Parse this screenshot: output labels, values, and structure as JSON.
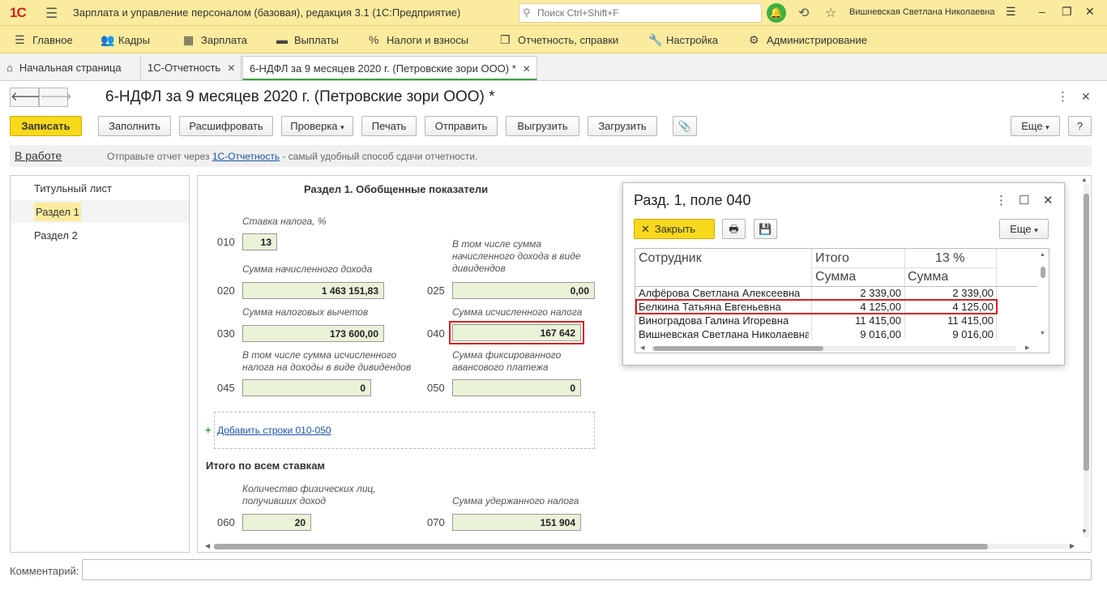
{
  "titlebar": {
    "logo": "1С",
    "app_title": "Зарплата и управление персоналом (базовая), редакция 3.1  (1С:Предприятие)",
    "search_placeholder": "Поиск Ctrl+Shift+F",
    "user": "Вишневская Светлана Николаевна"
  },
  "menu": [
    {
      "label": "Главное",
      "icon": "burger-icon"
    },
    {
      "label": "Кадры",
      "icon": "people-icon"
    },
    {
      "label": "Зарплата",
      "icon": "calculator-icon"
    },
    {
      "label": "Выплаты",
      "icon": "wallet-icon"
    },
    {
      "label": "Налоги и взносы",
      "icon": "percent-icon"
    },
    {
      "label": "Отчетность, справки",
      "icon": "report-icon"
    },
    {
      "label": "Настройка",
      "icon": "wrench-icon"
    },
    {
      "label": "Администрирование",
      "icon": "gear-icon"
    }
  ],
  "tabs": [
    {
      "label": "Начальная страница"
    },
    {
      "label": "1С-Отчетность"
    },
    {
      "label": "6-НДФЛ за 9 месяцев 2020 г. (Петровские зори ООО) *"
    }
  ],
  "document": {
    "title": "6-НДФЛ за 9 месяцев 2020 г. (Петровские зори ООО) *",
    "buttons": {
      "save": "Записать",
      "fill": "Заполнить",
      "decode": "Расшифровать",
      "check": "Проверка",
      "print": "Печать",
      "send": "Отправить",
      "upload": "Выгрузить",
      "download": "Загрузить",
      "more": "Еще",
      "help": "?"
    },
    "status": "В работе",
    "info_prefix": "Отправьте отчет через ",
    "info_link": "1С-Отчетность",
    "info_suffix": " - самый удобный способ сдачи отчетности."
  },
  "sections": [
    {
      "label": "Титульный лист"
    },
    {
      "label": "Раздел 1"
    },
    {
      "label": "Раздел 2"
    }
  ],
  "form": {
    "heading": "Раздел 1. Обобщенные показатели",
    "rate_label": "Ставка налога, %",
    "f010_code": "010",
    "f010_value": "13",
    "f020_label": "Сумма начисленного дохода",
    "f020_code": "020",
    "f020_value": "1 463 151,83",
    "f025_label": "В том числе сумма начисленного дохода в виде дивидендов",
    "f025_code": "025",
    "f025_value": "0,00",
    "f030_label": "Сумма налоговых вычетов",
    "f030_code": "030",
    "f030_value": "173 600,00",
    "f040_label": "Сумма исчисленного налога",
    "f040_code": "040",
    "f040_value": "167 642",
    "f045_label": "В том числе сумма исчисленного налога на доходы в виде дивидендов",
    "f045_code": "045",
    "f045_value": "0",
    "f050_label": "Сумма фиксированного авансового платежа",
    "f050_code": "050",
    "f050_value": "0",
    "add_rows": "Добавить строки 010-050",
    "total_heading": "Итого по всем ставкам",
    "f060_label": "Количество физических лиц, получивших доход",
    "f060_code": "060",
    "f060_value": "20",
    "f070_label": "Сумма удержанного налога",
    "f070_code": "070",
    "f070_value": "151 904"
  },
  "popup": {
    "title": "Разд. 1, поле 040",
    "close_button": "Закрыть",
    "more": "Еще",
    "col_employee": "Сотрудник",
    "col_total": "Итого",
    "col_rate": "13 %",
    "col_sum1": "Сумма",
    "col_sum2": "Сумма",
    "rows": [
      {
        "name": "Алфёрова Светлана Алексеевна",
        "total": "2 339,00",
        "rate13": "2 339,00"
      },
      {
        "name": "Белкина Татьяна Евгеньевна",
        "total": "4 125,00",
        "rate13": "4 125,00"
      },
      {
        "name": "Виноградова Галина Игоревна",
        "total": "11 415,00",
        "rate13": "11 415,00"
      },
      {
        "name": "Вишневская Светлана Николаевна",
        "total": "9 016,00",
        "rate13": "9 016,00"
      }
    ]
  },
  "comment_label": "Комментарий:",
  "colors": {
    "accent_yellow": "#fbeb9e",
    "highlight_red": "#d81f1f",
    "field_green": "#eaf2d8",
    "save_yellow": "#f8d91c"
  }
}
